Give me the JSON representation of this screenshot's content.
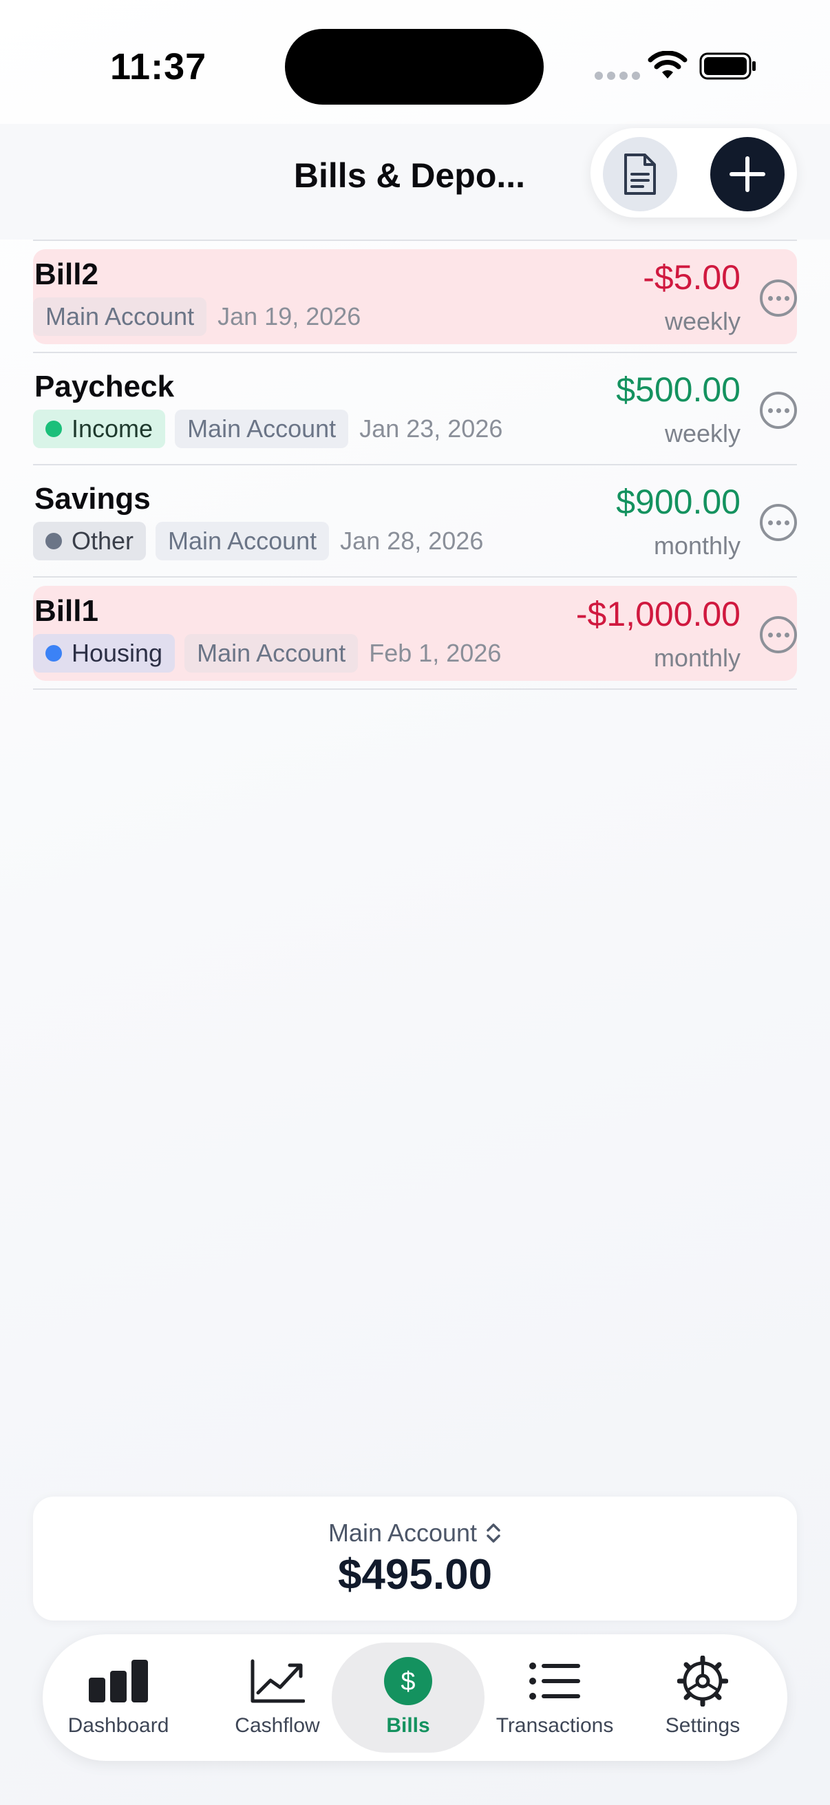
{
  "status_bar": {
    "time": "11:37"
  },
  "header": {
    "title": "Bills & Depo..."
  },
  "bills": [
    {
      "name": "Bill2",
      "category": null,
      "account": "Main Account",
      "date": "Jan 19, 2026",
      "amount": "-$5.00",
      "frequency": "weekly",
      "type": "bill"
    },
    {
      "name": "Paycheck",
      "category": "Income",
      "account": "Main Account",
      "date": "Jan 23, 2026",
      "amount": "$500.00",
      "frequency": "weekly",
      "type": "deposit"
    },
    {
      "name": "Savings",
      "category": "Other",
      "account": "Main Account",
      "date": "Jan 28, 2026",
      "amount": "$900.00",
      "frequency": "monthly",
      "type": "deposit"
    },
    {
      "name": "Bill1",
      "category": "Housing",
      "account": "Main Account",
      "date": "Feb 1, 2026",
      "amount": "-$1,000.00",
      "frequency": "monthly",
      "type": "bill"
    }
  ],
  "colors": {
    "income": "#1bbf7a",
    "other": "#6b7587",
    "housing": "#3b82f6",
    "negative": "#d0193f",
    "positive": "#14925f",
    "bill_row_bg": "#fde5e8"
  },
  "balance_card": {
    "account_name": "Main Account",
    "balance": "$495.00"
  },
  "tab_bar": {
    "tabs": [
      {
        "label": "Dashboard",
        "icon": "bar-chart-icon"
      },
      {
        "label": "Cashflow",
        "icon": "line-chart-icon"
      },
      {
        "label": "Bills",
        "icon": "dollar-circle-icon",
        "active": true
      },
      {
        "label": "Transactions",
        "icon": "list-icon"
      },
      {
        "label": "Settings",
        "icon": "gear-icon"
      }
    ]
  }
}
